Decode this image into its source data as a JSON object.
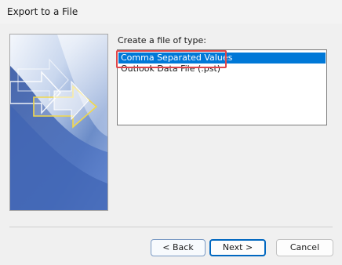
{
  "window": {
    "title": "Export to a File"
  },
  "file_type": {
    "label": "Create a file of type:",
    "options": [
      {
        "label": "Comma Separated Values",
        "selected": true
      },
      {
        "label": "Outlook Data File (.pst)",
        "selected": false
      }
    ]
  },
  "buttons": {
    "back": "< Back",
    "next": "Next >",
    "cancel": "Cancel"
  },
  "colors": {
    "selection": "#0078d7",
    "highlight_box": "#e0464a",
    "default_button_border": "#0067c0"
  },
  "icons": {
    "banner": "export-wizard-banner-arrows"
  }
}
